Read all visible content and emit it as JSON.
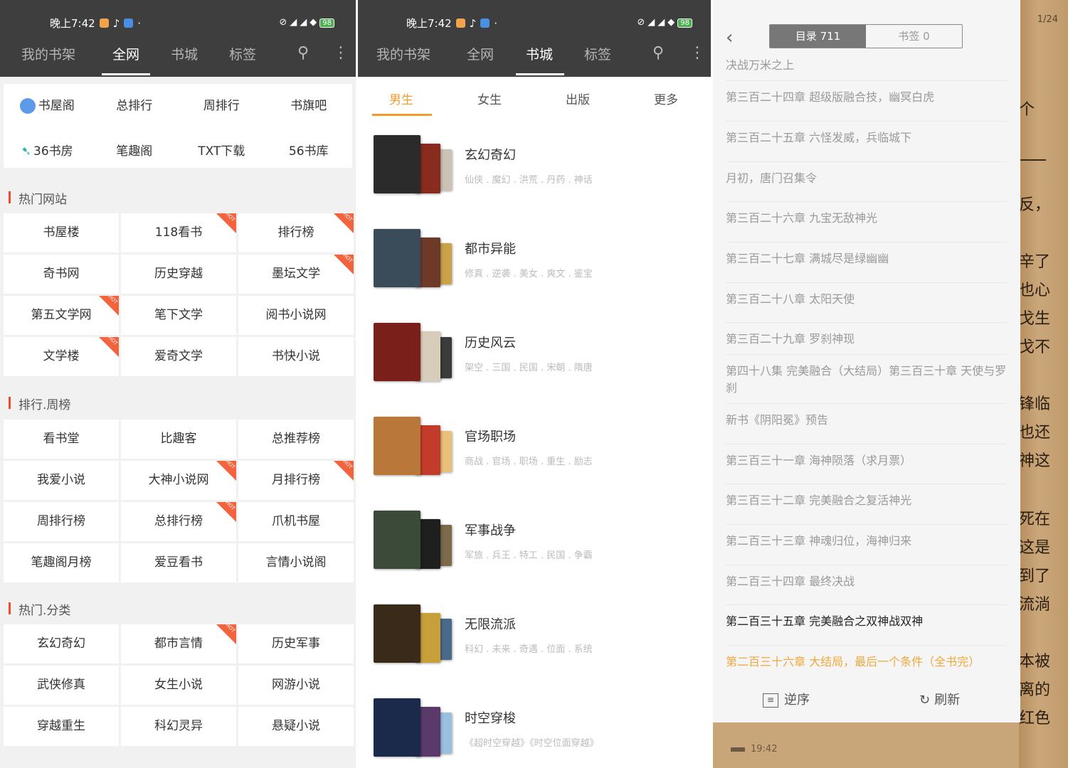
{
  "status": {
    "time": "晚上7:42",
    "battery": "98"
  },
  "nav": {
    "shelf": "我的书架",
    "web": "全网",
    "store": "书城",
    "tags": "标签"
  },
  "p1": {
    "row1": [
      "书屋阁",
      "总排行",
      "周排行",
      "书旗吧"
    ],
    "row2": [
      "36书房",
      "笔趣阁",
      "TXT下载",
      "56书库"
    ],
    "sec1": "热门网站",
    "grid1": [
      [
        "书屋楼",
        "118看书",
        "排行榜"
      ],
      [
        "奇书网",
        "历史穿越",
        "墨坛文学"
      ],
      [
        "第五文学网",
        "笔下文学",
        "阅书小说网"
      ],
      [
        "文学楼",
        "爱奇文学",
        "书快小说"
      ]
    ],
    "sec2": "排行.周榜",
    "grid2": [
      [
        "看书堂",
        "比趣客",
        "总推荐榜"
      ],
      [
        "我爱小说",
        "大神小说网",
        "月排行榜"
      ],
      [
        "周排行榜",
        "总排行榜",
        "爪机书屋"
      ],
      [
        "笔趣阁月榜",
        "爱豆看书",
        "言情小说阁"
      ]
    ],
    "sec3": "热门.分类",
    "grid3": [
      [
        "玄幻奇幻",
        "都市言情",
        "历史军事"
      ],
      [
        "武侠修真",
        "女生小说",
        "网游小说"
      ],
      [
        "穿越重生",
        "科幻灵异",
        "悬疑小说"
      ]
    ],
    "hot": "HOT"
  },
  "p2": {
    "cats": [
      "男生",
      "女生",
      "出版",
      "更多"
    ],
    "books": [
      {
        "title": "玄幻奇幻",
        "tags": "仙侠 . 魔幻 . 洪荒 . 丹药 . 神话"
      },
      {
        "title": "都市异能",
        "tags": "修真 . 逆袭 . 美女 . 爽文 . 鉴宝"
      },
      {
        "title": "历史风云",
        "tags": "架空 . 三国 . 民国 . 宋朝 . 隋唐"
      },
      {
        "title": "官场职场",
        "tags": "商战 . 官场 . 职场 . 重生 . 励志"
      },
      {
        "title": "军事战争",
        "tags": "军旅 . 兵王 . 特工 . 民国 . 争霸"
      },
      {
        "title": "无限流派",
        "tags": "科幻 . 未来 . 奇遇 . 位面 . 系统"
      },
      {
        "title": "时空穿梭",
        "tags": "《超时空穿越》《时空位面穿越》"
      }
    ]
  },
  "p3": {
    "toc_tab": "目录 711",
    "bm_tab": "书签 0",
    "chapters": [
      "决战万米之上",
      "第三百二十四章 超级版融合技，幽冥白虎",
      "第三百二十五章 六怪发威，兵临城下",
      "月初，唐门召集令",
      "第三百二十六章 九宝无敌神光",
      "第三百二十七章 满城尽是绿幽幽",
      "第三百二十八章 太阳天使",
      "第三百二十九章 罗刹神现",
      "第四十八集 完美融合（大结局）第三百三十章 天使与罗刹",
      "新书《阴阳冕》预告",
      "第三百三十一章 海神陨落（求月票）",
      "第三百三十二章 完美融合之复活神光",
      "第二百三十三章 神魂归位，海神归来",
      "第二百三十四章 最终决战",
      "第二百三十五章 完美融合之双神战双神",
      "第二百三十六章 大结局，最后一个条件（全书完）"
    ],
    "reverse": "逆序",
    "refresh": "刷新",
    "page": "1/24",
    "clock": "19:42",
    "reader_text": [
      "个",
      "反，",
      "辛了",
      "也心",
      "戈生",
      "戈不",
      "锋临",
      "也还",
      "神这",
      "死在",
      "这是",
      "到了",
      "流淌",
      "本被",
      "离的",
      "红色"
    ]
  }
}
